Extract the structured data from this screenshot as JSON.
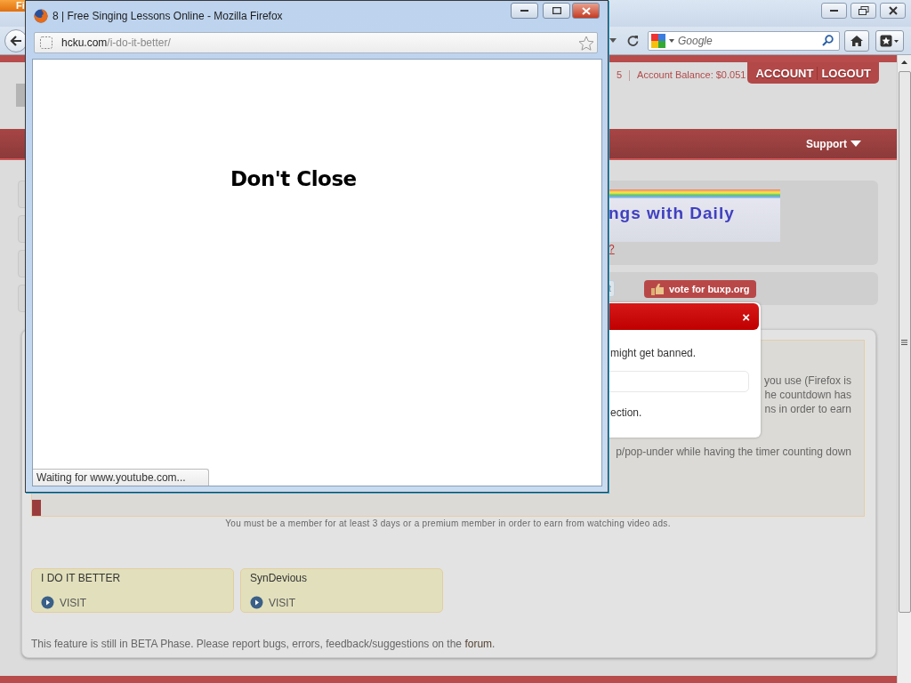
{
  "browser": {
    "menu_button": "Fi",
    "search": {
      "placeholder": "Google"
    }
  },
  "page": {
    "header": {
      "stat": "5",
      "balance": "Account Balance: $0.051",
      "menu": [
        {
          "label": "ACCOUNT"
        },
        {
          "label": "LOGOUT"
        }
      ]
    },
    "nav": {
      "support": "Support"
    },
    "banner": {
      "text": "ngs with Daily",
      "link": "?"
    },
    "vote": {
      "fragment": "t",
      "button": "vote for buxp.org"
    },
    "notice_paragraphs": [
      [
        "you use (Firefox is",
        "he countdown has",
        "ns in order to earn"
      ],
      [
        "p/pop-under while having the timer counting down"
      ]
    ],
    "member_note": "You must be a member for at least 3 days or a premium member in order to earn from watching video ads.",
    "sites": [
      {
        "name": "I DO IT BETTER",
        "action": "VISIT"
      },
      {
        "name": "SynDevious",
        "action": "VISIT"
      }
    ],
    "footer": {
      "text": "This feature is still in BETA Phase. Please report bugs, errors, feedback/suggestions on the",
      "link": "forum",
      "end": "."
    }
  },
  "dialog": {
    "close": "×",
    "lines": [
      "might get banned.",
      "ection."
    ]
  },
  "popup": {
    "title": "8 | Free Singing Lessons Online - Mozilla Firefox",
    "url_host": "hcku.com",
    "url_path": "/i-do-it-better/",
    "message": "Don't Close",
    "status": "Waiting for www.youtube.com..."
  }
}
